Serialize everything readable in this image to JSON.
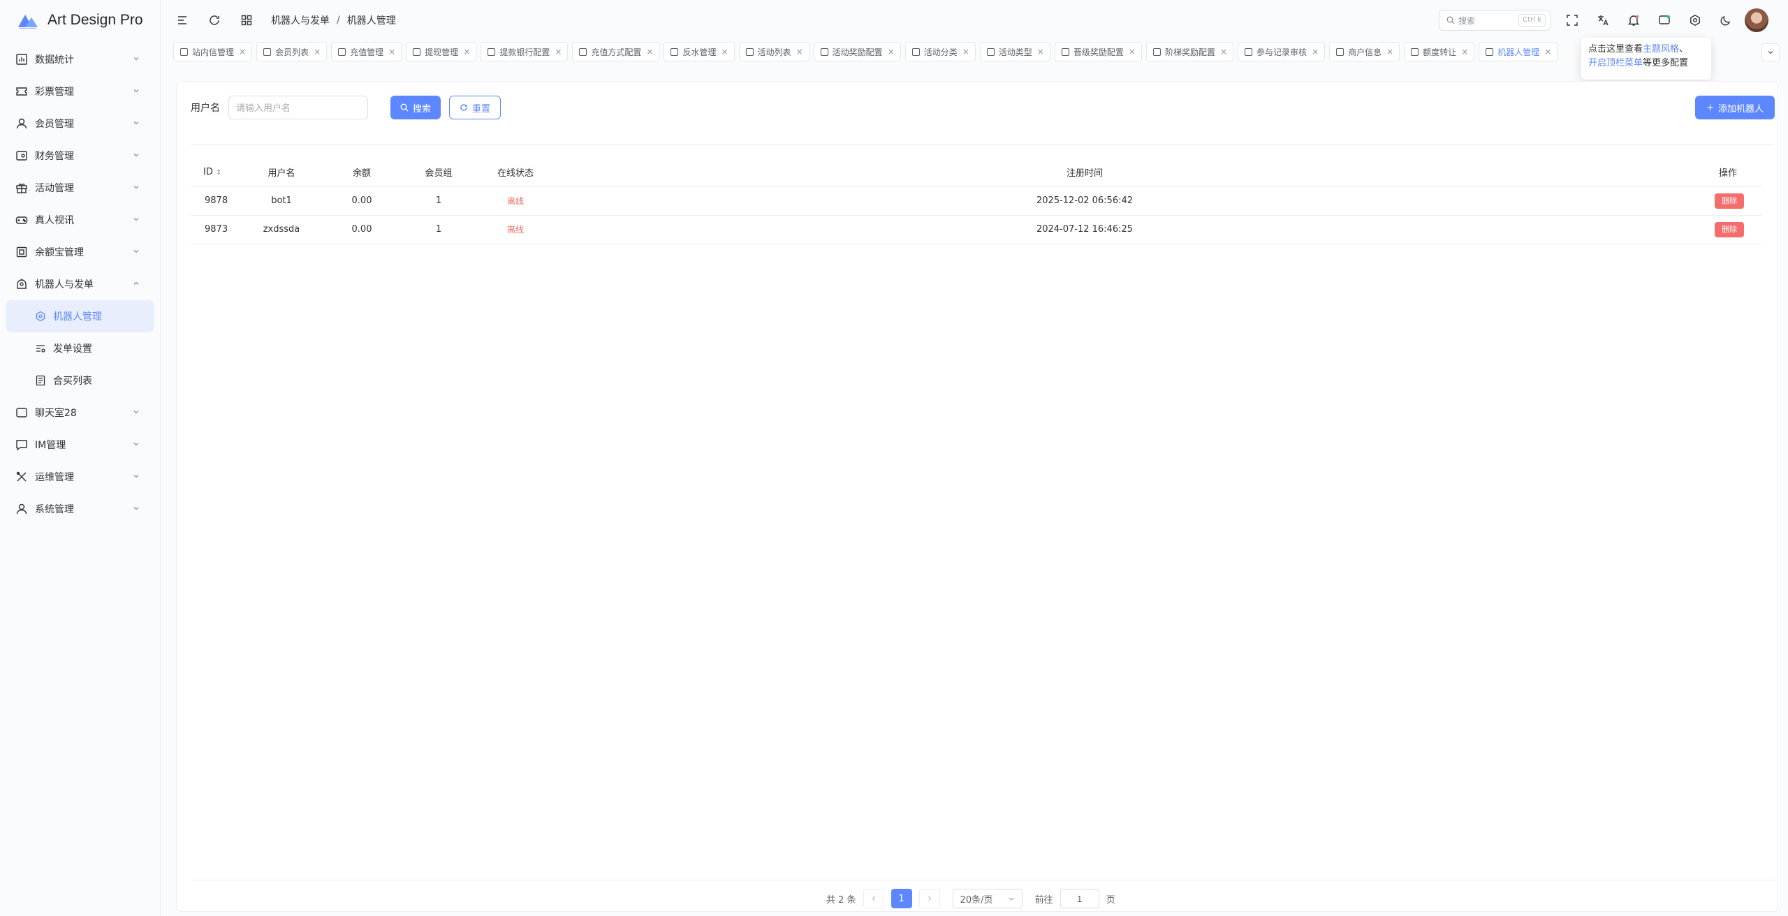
{
  "app": {
    "title": "Art Design Pro",
    "accent": "#5d87ff",
    "danger": "#f56c6c"
  },
  "sidebar": {
    "items": [
      {
        "label": "数据统计",
        "icon": "chart-icon"
      },
      {
        "label": "彩票管理",
        "icon": "ticket-icon"
      },
      {
        "label": "会员管理",
        "icon": "user-icon"
      },
      {
        "label": "财务管理",
        "icon": "wallet-icon"
      },
      {
        "label": "活动管理",
        "icon": "gift-icon"
      },
      {
        "label": "真人视讯",
        "icon": "gamepad-icon"
      },
      {
        "label": "余额宝管理",
        "icon": "box-icon"
      },
      {
        "label": "机器人与发单",
        "icon": "robot-icon"
      }
    ],
    "sub_items": [
      {
        "label": "机器人管理",
        "icon": "gear-icon",
        "active": true
      },
      {
        "label": "发单设置",
        "icon": "filter-icon"
      },
      {
        "label": "合买列表",
        "icon": "list-icon"
      }
    ],
    "items_after": [
      {
        "label": "聊天室28",
        "icon": "chat-icon"
      },
      {
        "label": "IM管理",
        "icon": "message-icon"
      },
      {
        "label": "运维管理",
        "icon": "tools-icon"
      },
      {
        "label": "系统管理",
        "icon": "user-icon"
      }
    ]
  },
  "header": {
    "breadcrumb": [
      "机器人与发单",
      "机器人管理"
    ],
    "search_placeholder": "搜索",
    "search_shortcut": "Ctrl k"
  },
  "tabs": [
    "站内信管理",
    "会员列表",
    "充值管理",
    "提现管理",
    "提款银行配置",
    "充值方式配置",
    "反水管理",
    "活动列表",
    "活动奖励配置",
    "活动分类",
    "活动类型",
    "晋级奖励配置",
    "阶梯奖励配置",
    "参与记录审核",
    "商户信息",
    "额度转让",
    "机器人管理"
  ],
  "tooltip": {
    "prefix": "点击这里查看",
    "link1": "主题风格",
    "suffix1": "、",
    "link2": "开启顶栏菜单",
    "suffix2": "等更多配置"
  },
  "filter": {
    "label": "用户名",
    "placeholder": "请输入用户名",
    "search_label": "搜索",
    "reset_label": "重置",
    "add_label": "添加机器人"
  },
  "table": {
    "columns": [
      "ID",
      "用户名",
      "余额",
      "会员组",
      "在线状态",
      "注册时间",
      "操作"
    ],
    "rows": [
      {
        "id": "9878",
        "username": "bot1",
        "balance": "0.00",
        "group": "1",
        "status": "离线",
        "registered": "2025-12-02 06:56:42",
        "action": "删除"
      },
      {
        "id": "9873",
        "username": "zxdssda",
        "balance": "0.00",
        "group": "1",
        "status": "离线",
        "registered": "2024-07-12 16:46:25",
        "action": "删除"
      }
    ]
  },
  "pagination": {
    "total": "共 2 条",
    "current": "1",
    "page_size": "20条/页",
    "goto_prefix": "前往",
    "goto_value": "1",
    "goto_suffix": "页"
  }
}
